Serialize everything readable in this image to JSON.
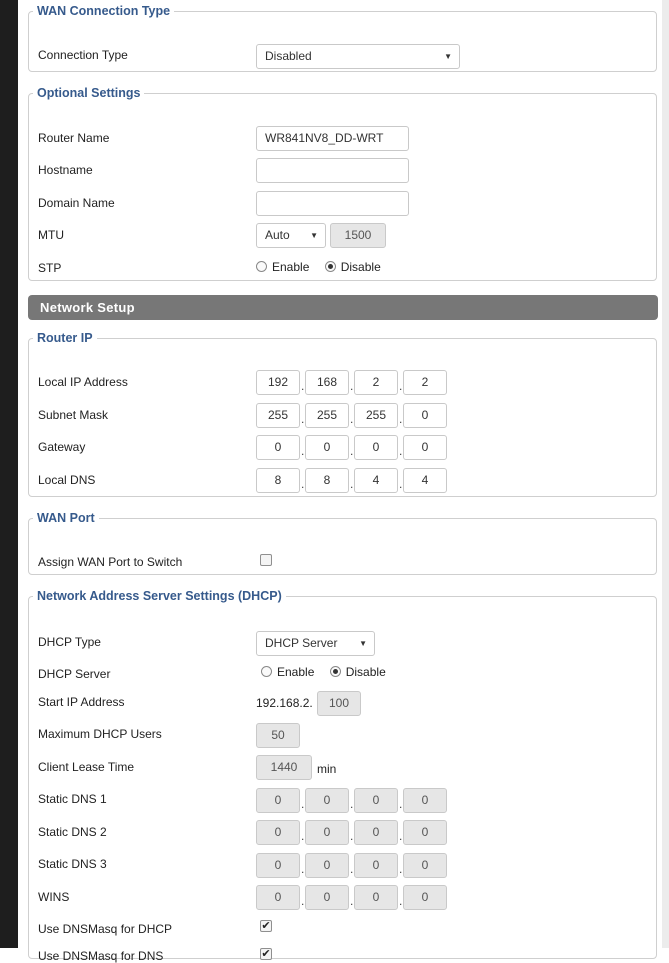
{
  "wan_connection": {
    "legend": "WAN Connection Type",
    "connection_type_label": "Connection Type",
    "connection_type_value": "Disabled"
  },
  "optional_settings": {
    "legend": "Optional Settings",
    "router_name_label": "Router Name",
    "router_name_value": "WR841NV8_DD-WRT",
    "hostname_label": "Hostname",
    "hostname_value": "",
    "domain_name_label": "Domain Name",
    "domain_name_value": "",
    "mtu_label": "MTU",
    "mtu_mode": "Auto",
    "mtu_value": "1500",
    "stp_label": "STP",
    "stp_enable": "Enable",
    "stp_disable": "Disable",
    "stp_selected": "Disable"
  },
  "network_setup": {
    "title": "Network Setup"
  },
  "router_ip": {
    "legend": "Router IP",
    "local_ip_label": "Local IP Address",
    "local_ip": [
      "192",
      "168",
      "2",
      "2"
    ],
    "subnet_mask_label": "Subnet Mask",
    "subnet_mask": [
      "255",
      "255",
      "255",
      "0"
    ],
    "gateway_label": "Gateway",
    "gateway": [
      "0",
      "0",
      "0",
      "0"
    ],
    "local_dns_label": "Local DNS",
    "local_dns": [
      "8",
      "8",
      "4",
      "4"
    ]
  },
  "wan_port": {
    "legend": "WAN Port",
    "assign_label": "Assign WAN Port to Switch",
    "assign_checked": false
  },
  "dhcp": {
    "legend": "Network Address Server Settings (DHCP)",
    "type_label": "DHCP Type",
    "type_value": "DHCP Server",
    "server_label": "DHCP Server",
    "server_enable": "Enable",
    "server_disable": "Disable",
    "server_selected": "Disable",
    "start_ip_label": "Start IP Address",
    "start_ip_prefix": "192.168.2.",
    "start_ip_last": "100",
    "max_users_label": "Maximum DHCP Users",
    "max_users_value": "50",
    "lease_label": "Client Lease Time",
    "lease_value": "1440",
    "lease_unit": "min",
    "static_dns1_label": "Static DNS 1",
    "static_dns1": [
      "0",
      "0",
      "0",
      "0"
    ],
    "static_dns2_label": "Static DNS 2",
    "static_dns2": [
      "0",
      "0",
      "0",
      "0"
    ],
    "static_dns3_label": "Static DNS 3",
    "static_dns3": [
      "0",
      "0",
      "0",
      "0"
    ],
    "wins_label": "WINS",
    "wins": [
      "0",
      "0",
      "0",
      "0"
    ],
    "dnsmasq_dhcp_label": "Use DNSMasq for DHCP",
    "dnsmasq_dhcp_checked": true,
    "dnsmasq_dns_label": "Use DNSMasq for DNS",
    "dnsmasq_dns_checked": true
  }
}
